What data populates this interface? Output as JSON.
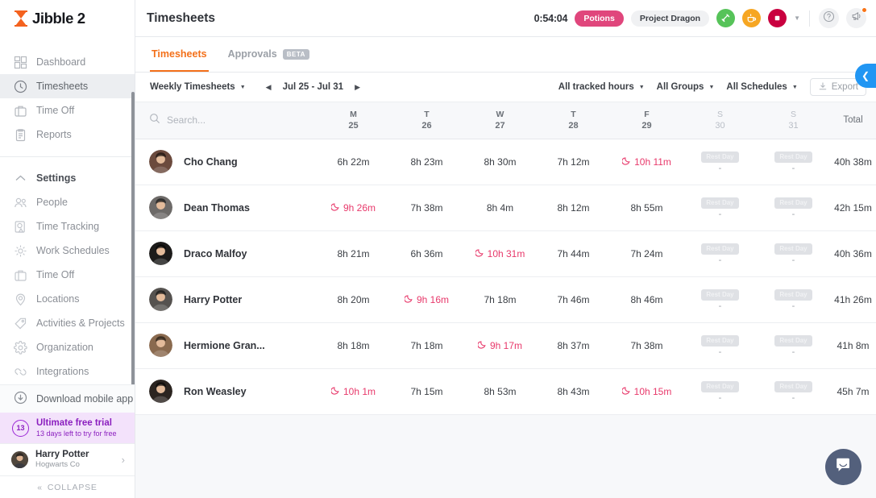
{
  "brand": {
    "name": "Jibble 2",
    "logo_icon": "hourglass-icon"
  },
  "sidebar": {
    "primary_items": [
      {
        "label": "Dashboard",
        "icon": "dashboard-icon",
        "active": false
      },
      {
        "label": "Timesheets",
        "icon": "clock-icon",
        "active": true
      },
      {
        "label": "Time Off",
        "icon": "briefcase-icon",
        "active": false
      },
      {
        "label": "Reports",
        "icon": "clipboard-icon",
        "active": false
      }
    ],
    "settings_label": "Settings",
    "settings_icon": "chevron-up-icon",
    "settings_items": [
      {
        "label": "People",
        "icon": "people-icon"
      },
      {
        "label": "Time Tracking",
        "icon": "time-tracking-icon"
      },
      {
        "label": "Work Schedules",
        "icon": "work-schedules-icon"
      },
      {
        "label": "Time Off",
        "icon": "briefcase-icon"
      },
      {
        "label": "Locations",
        "icon": "location-pin-icon"
      },
      {
        "label": "Activities & Projects",
        "icon": "tag-icon"
      },
      {
        "label": "Organization",
        "icon": "gear-icon"
      },
      {
        "label": "Integrations",
        "icon": "integrations-icon"
      }
    ],
    "download_app": {
      "label": "Download mobile app",
      "icon": "download-icon"
    },
    "trial": {
      "days_badge": "13",
      "title": "Ultimate free trial",
      "subtitle": "13 days left to try for free"
    },
    "user": {
      "name": "Harry Potter",
      "org": "Hogwarts Co",
      "chevron_icon": "chevron-right-icon",
      "avatar_icon": "avatar"
    },
    "collapse": {
      "label": "COLLAPSE",
      "icon": "double-chevron-left-icon"
    }
  },
  "header": {
    "title": "Timesheets",
    "timer": "0:54:04",
    "activity_pill": "Potions",
    "project_pill": "Project Dragon",
    "buttons": [
      {
        "name": "switch-activity-button",
        "icon": "switch-icon",
        "color": "#56c359"
      },
      {
        "name": "break-button",
        "icon": "coffee-icon",
        "color": "#f6a623"
      },
      {
        "name": "stop-button",
        "icon": "stop-icon",
        "color": "#c9003f"
      }
    ],
    "more_caret_icon": "chevron-down-icon",
    "help_icon": "question-circle-icon",
    "announcements_icon": "announcement-icon",
    "announcements_has_badge": true
  },
  "tabs": [
    {
      "label": "Timesheets",
      "active": true,
      "badge": ""
    },
    {
      "label": "Approvals",
      "active": false,
      "badge": "BETA"
    }
  ],
  "filters": {
    "view_mode": "Weekly Timesheets",
    "prev_icon": "chevron-left-icon",
    "next_icon": "chevron-right-icon",
    "date_range": "Jul 25 - Jul 31",
    "tracked_hours": "All tracked hours",
    "groups": "All Groups",
    "schedules": "All Schedules",
    "export": "Export",
    "export_icon": "download-icon"
  },
  "search": {
    "placeholder": "Search...",
    "value": "",
    "icon": "search-icon"
  },
  "table": {
    "columns": [
      {
        "dow": "M",
        "date": "25",
        "weekend": false
      },
      {
        "dow": "T",
        "date": "26",
        "weekend": false
      },
      {
        "dow": "W",
        "date": "27",
        "weekend": false
      },
      {
        "dow": "T",
        "date": "28",
        "weekend": false
      },
      {
        "dow": "F",
        "date": "29",
        "weekend": false
      },
      {
        "dow": "S",
        "date": "30",
        "weekend": true
      },
      {
        "dow": "S",
        "date": "31",
        "weekend": true
      }
    ],
    "total_label": "Total",
    "rest_day_label": "Rest Day",
    "rest_day_value": "-",
    "overtime_icon": "moon-icon",
    "rows": [
      {
        "name": "Cho Chang",
        "avatar_bg": "#6b4a3d",
        "days": [
          {
            "value": "6h 22m",
            "overtime": false
          },
          {
            "value": "8h 23m",
            "overtime": false
          },
          {
            "value": "8h 30m",
            "overtime": false
          },
          {
            "value": "7h 12m",
            "overtime": false
          },
          {
            "value": "10h 11m",
            "overtime": true
          },
          {
            "rest": true
          },
          {
            "rest": true
          }
        ],
        "total": "40h 38m"
      },
      {
        "name": "Dean Thomas",
        "avatar_bg": "#6d6a68",
        "days": [
          {
            "value": "9h 26m",
            "overtime": true
          },
          {
            "value": "7h 38m",
            "overtime": false
          },
          {
            "value": "8h 4m",
            "overtime": false
          },
          {
            "value": "8h 12m",
            "overtime": false
          },
          {
            "value": "8h 55m",
            "overtime": false
          },
          {
            "rest": true
          },
          {
            "rest": true
          }
        ],
        "total": "42h 15m"
      },
      {
        "name": "Draco Malfoy",
        "avatar_bg": "#1c1b1a",
        "days": [
          {
            "value": "8h 21m",
            "overtime": false
          },
          {
            "value": "6h 36m",
            "overtime": false
          },
          {
            "value": "10h 31m",
            "overtime": true
          },
          {
            "value": "7h 44m",
            "overtime": false
          },
          {
            "value": "7h 24m",
            "overtime": false
          },
          {
            "rest": true
          },
          {
            "rest": true
          }
        ],
        "total": "40h 36m"
      },
      {
        "name": "Harry Potter",
        "avatar_bg": "#55524f",
        "days": [
          {
            "value": "8h 20m",
            "overtime": false
          },
          {
            "value": "9h 16m",
            "overtime": true
          },
          {
            "value": "7h 18m",
            "overtime": false
          },
          {
            "value": "7h 46m",
            "overtime": false
          },
          {
            "value": "8h 46m",
            "overtime": false
          },
          {
            "rest": true
          },
          {
            "rest": true
          }
        ],
        "total": "41h 26m"
      },
      {
        "name": "Hermione Gran...",
        "avatar_bg": "#8a6a4f",
        "days": [
          {
            "value": "8h 18m",
            "overtime": false
          },
          {
            "value": "7h 18m",
            "overtime": false
          },
          {
            "value": "9h 17m",
            "overtime": true
          },
          {
            "value": "8h 37m",
            "overtime": false
          },
          {
            "value": "7h 38m",
            "overtime": false
          },
          {
            "rest": true
          },
          {
            "rest": true
          }
        ],
        "total": "41h 8m"
      },
      {
        "name": "Ron Weasley",
        "avatar_bg": "#2b2420",
        "days": [
          {
            "value": "10h 1m",
            "overtime": true
          },
          {
            "value": "7h 15m",
            "overtime": false
          },
          {
            "value": "8h 53m",
            "overtime": false
          },
          {
            "value": "8h 43m",
            "overtime": false
          },
          {
            "value": "10h 15m",
            "overtime": true
          },
          {
            "rest": true
          },
          {
            "rest": true
          }
        ],
        "total": "45h 7m"
      }
    ]
  },
  "floating": {
    "side_panel_toggle_icon": "chevron-left-icon",
    "chat_icon": "chat-bubble-icon"
  },
  "colors": {
    "accent_orange": "#f3701a",
    "overtime_red": "#e8396b",
    "trial_purple": "#8b1fbf",
    "toggle_blue": "#2196f3"
  }
}
